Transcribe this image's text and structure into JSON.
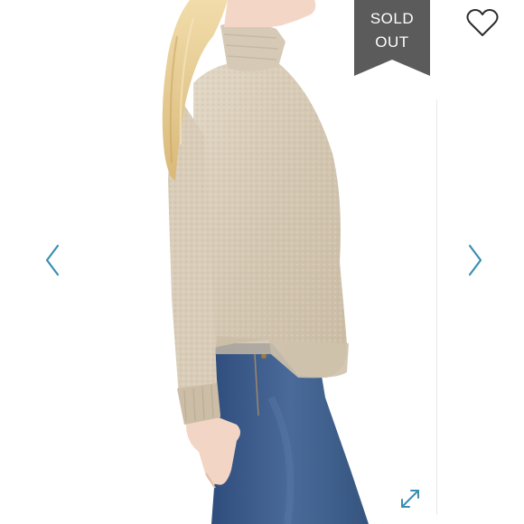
{
  "banner": {
    "line1": "SOLD",
    "line2": "OUT",
    "color": "#5b5b5b"
  },
  "icons": {
    "like": "heart-outline-icon",
    "prev": "chevron-left-icon",
    "next": "chevron-right-icon",
    "expand": "expand-diagonal-icon"
  },
  "colors": {
    "accent": "#3a8fb3",
    "heart": "#2b2b2b",
    "sweater": "#d7cbb7",
    "jeans": "#3e5f8f",
    "hair": "#e9cf94"
  }
}
